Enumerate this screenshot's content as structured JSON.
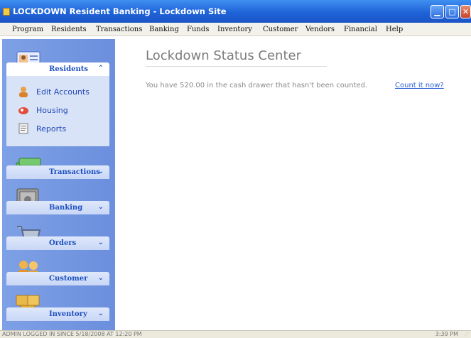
{
  "window": {
    "title": "LOCKDOWN Resident Banking - Lockdown Site"
  },
  "menu": [
    "Program",
    "Residents",
    "Transactions",
    "Banking",
    "Funds",
    "Inventory",
    "Customer",
    "Vendors",
    "Financial",
    "Help"
  ],
  "sidebar": {
    "groups": [
      {
        "label": "Residents",
        "icon": "resident-card-icon",
        "expanded": true,
        "items": [
          {
            "label": "Edit Accounts",
            "icon": "person-icon"
          },
          {
            "label": "Housing",
            "icon": "housing-icon"
          },
          {
            "label": "Reports",
            "icon": "report-icon"
          }
        ]
      },
      {
        "label": "Transactions",
        "icon": "money-stack-icon",
        "expanded": false
      },
      {
        "label": "Banking",
        "icon": "safe-icon",
        "expanded": false
      },
      {
        "label": "Orders",
        "icon": "shopping-cart-icon",
        "expanded": false
      },
      {
        "label": "Customer",
        "icon": "people-icon",
        "expanded": false
      },
      {
        "label": "Inventory",
        "icon": "boxes-icon",
        "expanded": false
      }
    ]
  },
  "main": {
    "title": "Lockdown Status Center",
    "message": "You have 520.00 in the cash drawer that hasn't been counted.",
    "link": "Count it now?"
  },
  "status": {
    "left": "ADMIN LOGGED IN SINCE 5/18/2008 AT 12:20 PM",
    "right": "3:39 PM"
  },
  "colors": {
    "title_bar": "#1f63d8",
    "sidebar": "#6b8fdd",
    "link": "#2a5fd6",
    "menu_text": "#1d4fc0"
  }
}
